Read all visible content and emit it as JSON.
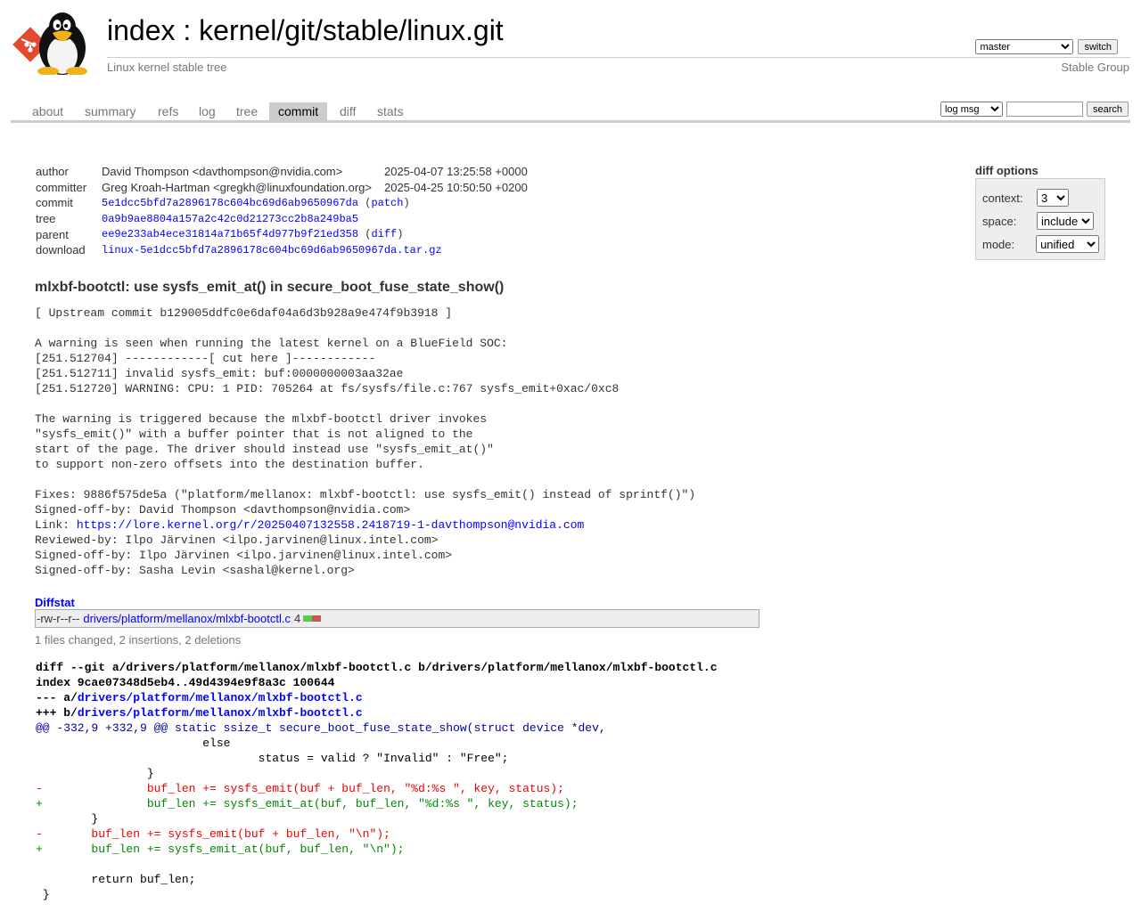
{
  "header": {
    "title_index": "index",
    "title_sep": " : ",
    "title_repo": "kernel/git/stable/linux.git",
    "subtitle": "Linux kernel stable tree",
    "owner": "Stable Group",
    "branch_selected": "master",
    "switch_label": "switch"
  },
  "tabs": [
    "about",
    "summary",
    "refs",
    "log",
    "tree",
    "commit",
    "diff",
    "stats"
  ],
  "active_tab": "commit",
  "search": {
    "select_value": "log msg",
    "button_label": "search"
  },
  "commit_info": {
    "author_label": "author",
    "author": "David Thompson <davthompson@nvidia.com>",
    "author_date": "2025-04-07 13:25:58 +0000",
    "committer_label": "committer",
    "committer": "Greg Kroah-Hartman <gregkh@linuxfoundation.org>",
    "committer_date": "2025-04-25 10:50:50 +0200",
    "commit_label": "commit",
    "commit": "5e1dcc5bfd7a2896178c604bc69d6ab9650967da",
    "patch_link": "patch",
    "tree_label": "tree",
    "tree": "0a9b9ae8804a157a2c42c0d21273cc2b8a249ba5",
    "parent_label": "parent",
    "parent": "ee9e233ab4ece31814a71b65f4d977b9f21ed358",
    "diff_link": "diff",
    "download_label": "download",
    "download": "linux-5e1dcc5bfd7a2896178c604bc69d6ab9650967da.tar.gz"
  },
  "diff_options": {
    "title": "diff options",
    "context_label": "context:",
    "context_value": "3",
    "space_label": "space:",
    "space_value": "include",
    "mode_label": "mode:",
    "mode_value": "unified"
  },
  "message": {
    "subject": "mlxbf-bootctl: use sysfs_emit_at() in secure_boot_fuse_state_show()",
    "body": "[ Upstream commit b129005ddfc0e6daf04a6d3b928a9e474f9b3918 ]\n\nA warning is seen when running the latest kernel on a BlueField SOC:\n[251.512704] ------------[ cut here ]------------\n[251.512711] invalid sysfs_emit: buf:0000000003aa32ae\n[251.512720] WARNING: CPU: 1 PID: 705264 at fs/sysfs/file.c:767 sysfs_emit+0xac/0xc8\n\nThe warning is triggered because the mlxbf-bootctl driver invokes\n\"sysfs_emit()\" with a buffer pointer that is not aligned to the\nstart of the page. The driver should instead use \"sysfs_emit_at()\"\nto support non-zero offsets into the destination buffer.\n\nFixes: 9886f575de5a (\"platform/mellanox: mlxbf-bootctl: use sysfs_emit() instead of sprintf()\")\nSigned-off-by: David Thompson <davthompson@nvidia.com>",
    "link_prefix": "Link: ",
    "link_url": "https://lore.kernel.org/r/20250407132558.2418719-1-davthompson@nvidia.com",
    "body_tail": "Reviewed-by: Ilpo Järvinen <ilpo.jarvinen@linux.intel.com>\nSigned-off-by: Ilpo Järvinen <ilpo.jarvinen@linux.intel.com>\nSigned-off-by: Sasha Levin <sashal@kernel.org>"
  },
  "diffstat": {
    "heading": "Diffstat",
    "mode": "-rw-r--r--",
    "file": "drivers/platform/mellanox/mlxbf-bootctl.c",
    "count": "4",
    "summary": "1 files changed, 2 insertions, 2 deletions"
  },
  "diff": {
    "line1": "diff --git a/drivers/platform/mellanox/mlxbf-bootctl.c b/drivers/platform/mellanox/mlxbf-bootctl.c",
    "line2": "index 9cae07348d5eb4..49d4394e9f8a3c 100644",
    "minus_prefix": "--- a/",
    "plus_prefix": "+++ b/",
    "file": "drivers/platform/mellanox/mlxbf-bootctl.c",
    "lines": [
      {
        "type": "hunk",
        "text": "@@ -332,9 +332,9 @@ static ssize_t secure_boot_fuse_state_show(struct device *dev,"
      },
      {
        "type": "ctx",
        "text": " \t\t\telse"
      },
      {
        "type": "ctx",
        "text": " \t\t\t\tstatus = valid ? \"Invalid\" : \"Free\";"
      },
      {
        "type": "ctx",
        "text": " \t\t}"
      },
      {
        "type": "del",
        "text": "-\t\tbuf_len += sysfs_emit(buf + buf_len, \"%d:%s \", key, status);"
      },
      {
        "type": "add",
        "text": "+\t\tbuf_len += sysfs_emit_at(buf, buf_len, \"%d:%s \", key, status);"
      },
      {
        "type": "ctx",
        "text": " \t}"
      },
      {
        "type": "del",
        "text": "-\tbuf_len += sysfs_emit(buf + buf_len, \"\\n\");"
      },
      {
        "type": "add",
        "text": "+\tbuf_len += sysfs_emit_at(buf, buf_len, \"\\n\");"
      },
      {
        "type": "ctx",
        "text": " "
      },
      {
        "type": "ctx",
        "text": " \treturn buf_len;"
      },
      {
        "type": "ctx",
        "text": " }"
      }
    ]
  },
  "colors": {
    "link": "#0000ff",
    "add": "#008800",
    "del": "#ee0000",
    "tab_active_bg": "#cccccc"
  }
}
